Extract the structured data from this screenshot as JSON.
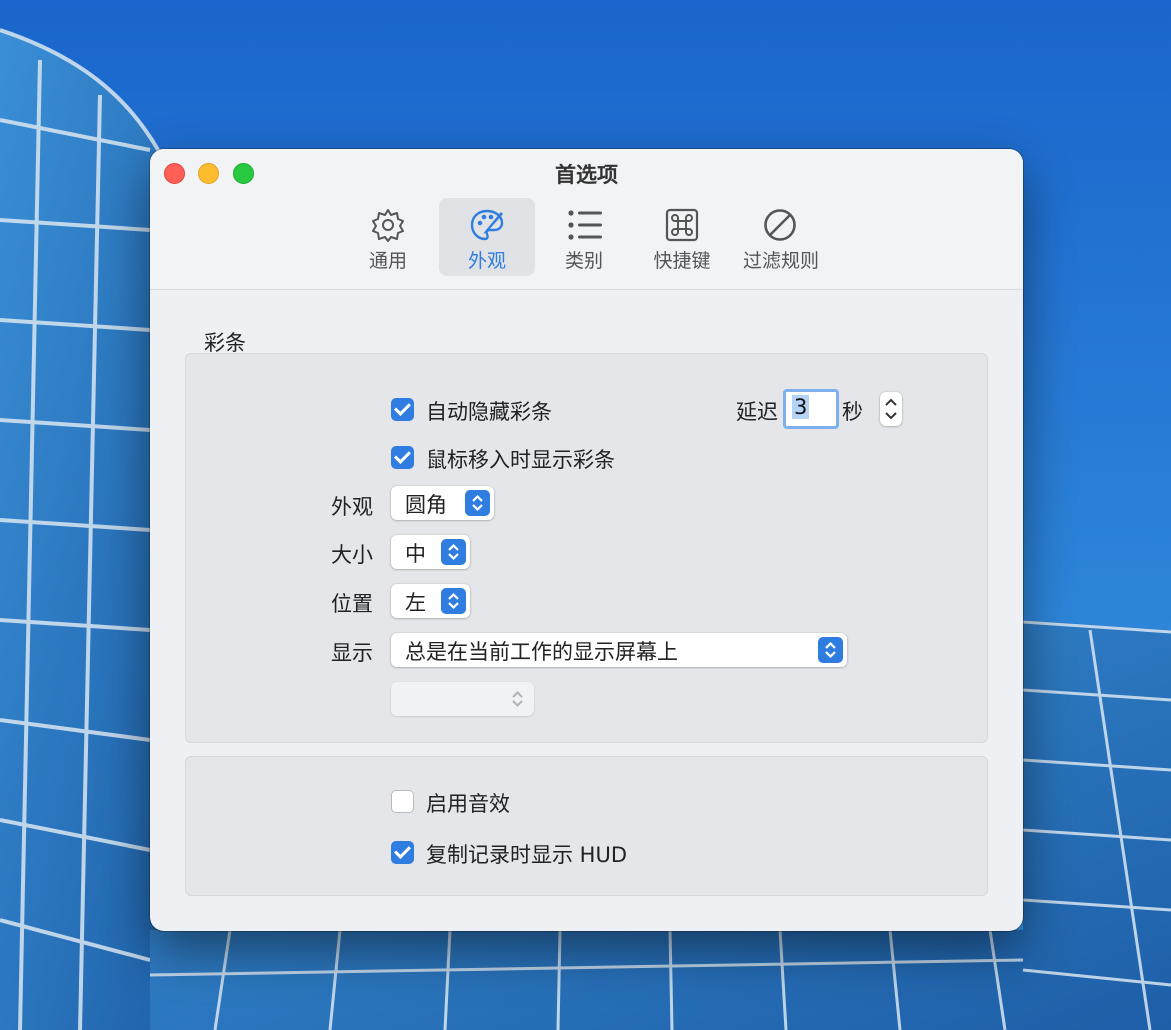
{
  "window": {
    "title": "首选项"
  },
  "tabs": [
    {
      "label": "通用",
      "icon": "gear-icon"
    },
    {
      "label": "外观",
      "icon": "palette-icon",
      "active": true
    },
    {
      "label": "类别",
      "icon": "list-icon"
    },
    {
      "label": "快捷键",
      "icon": "command-icon"
    },
    {
      "label": "过滤规则",
      "icon": "prohibited-icon"
    }
  ],
  "section": {
    "title": "彩条"
  },
  "options": {
    "auto_hide": {
      "label": "自动隐藏彩条",
      "checked": true
    },
    "delay": {
      "label": "延迟",
      "value": "3",
      "unit": "秒"
    },
    "show_on_hover": {
      "label": "鼠标移入时显示彩条",
      "checked": true
    },
    "appearance": {
      "label": "外观",
      "value": "圆角"
    },
    "size": {
      "label": "大小",
      "value": "中"
    },
    "position": {
      "label": "位置",
      "value": "左"
    },
    "display": {
      "label": "显示",
      "value": "总是在当前工作的显示屏幕上"
    },
    "sound": {
      "label": "启用音效",
      "checked": false
    },
    "hud": {
      "label": "复制记录时显示 HUD",
      "checked": true
    }
  },
  "colors": {
    "accent": "#2f7de0",
    "window_bg": "#eef0f3",
    "panel_bg": "#e4e6e9"
  }
}
